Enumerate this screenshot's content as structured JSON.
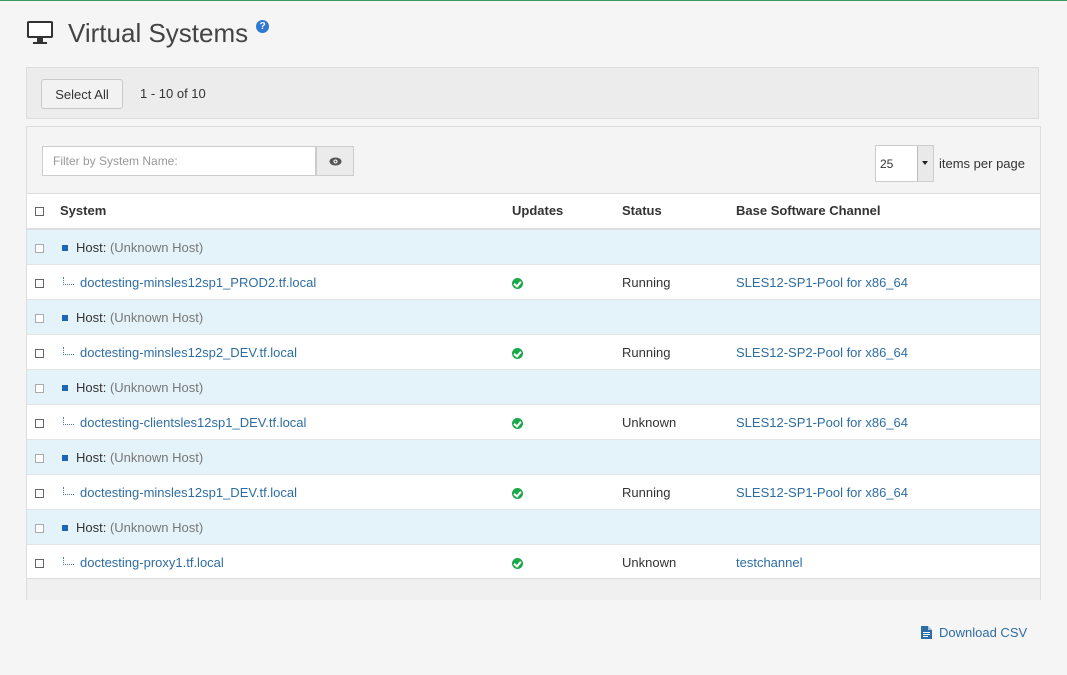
{
  "page": {
    "title": "Virtual Systems",
    "help": "?"
  },
  "toolbar": {
    "select_all": "Select All",
    "count": "1 - 10 of 10"
  },
  "filter": {
    "placeholder": "Filter by System Name:",
    "per_page": "25",
    "per_page_label": "items per page"
  },
  "table": {
    "headers": {
      "system": "System",
      "updates": "Updates",
      "status": "Status",
      "channel": "Base Software Channel"
    },
    "host_label": "Host:",
    "rows": [
      {
        "host": "(Unknown Host)",
        "system": "doctesting-minsles12sp1_PROD2.tf.local",
        "status": "Running",
        "channel": "SLES12-SP1-Pool for x86_64"
      },
      {
        "host": "(Unknown Host)",
        "system": "doctesting-minsles12sp2_DEV.tf.local",
        "status": "Running",
        "channel": "SLES12-SP2-Pool for x86_64"
      },
      {
        "host": "(Unknown Host)",
        "system": "doctesting-clientsles12sp1_DEV.tf.local",
        "status": "Unknown",
        "channel": "SLES12-SP1-Pool for x86_64"
      },
      {
        "host": "(Unknown Host)",
        "system": "doctesting-minsles12sp1_DEV.tf.local",
        "status": "Running",
        "channel": "SLES12-SP1-Pool for x86_64"
      },
      {
        "host": "(Unknown Host)",
        "system": "doctesting-proxy1.tf.local",
        "status": "Unknown",
        "channel": "testchannel"
      }
    ]
  },
  "footer": {
    "download_csv": "Download CSV"
  },
  "colors": {
    "accent": "#3c9a5f",
    "link": "#2e6da4",
    "ok": "#1ba84b",
    "host_row": "#e4f3fa"
  }
}
